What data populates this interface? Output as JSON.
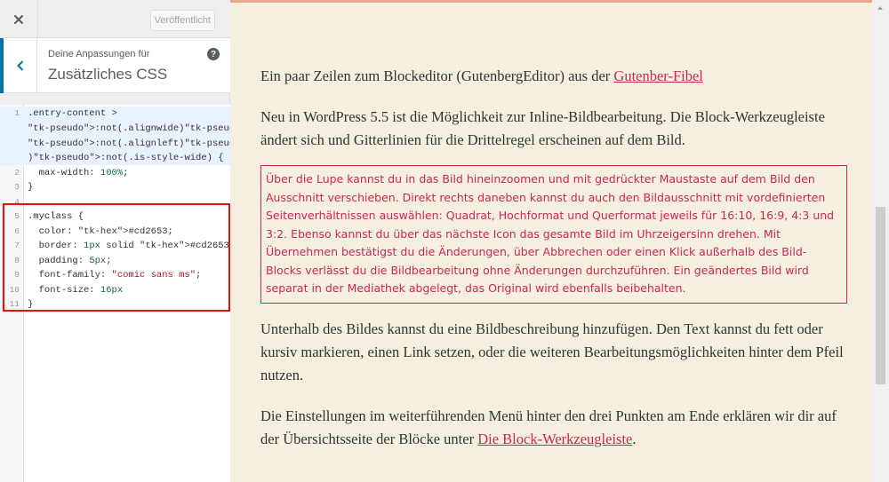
{
  "topbar": {
    "close_icon": "close-icon",
    "publish_label": "Veröffentlicht"
  },
  "section": {
    "back_icon": "chevron-left-icon",
    "kicker": "Deine Anpassungen für",
    "title": "Zusätzliches CSS",
    "help_icon": "help-icon",
    "help_glyph": "?"
  },
  "css_editor": {
    "lines": [
      {
        "n": "1",
        "text": ".entry-content >"
      },
      {
        "n": "",
        "text": ":not(.alignwide):not(.alignfull)"
      },
      {
        "n": "",
        "text": ":not(.alignleft):not(.alignright"
      },
      {
        "n": "",
        "text": "):not(.is-style-wide) {"
      },
      {
        "n": "2",
        "text": "  max-width: 100%;"
      },
      {
        "n": "3",
        "text": "}"
      },
      {
        "n": "4",
        "text": ""
      },
      {
        "n": "5",
        "text": ".myclass {"
      },
      {
        "n": "6",
        "text": "  color: #cd2653;"
      },
      {
        "n": "7",
        "text": "  border: 1px solid #cd2653;"
      },
      {
        "n": "8",
        "text": "  padding: 5px;"
      },
      {
        "n": "9",
        "text": "  font-family: \"comic sans ms\";"
      },
      {
        "n": "10",
        "text": "  font-size: 16px"
      },
      {
        "n": "11",
        "text": "}"
      }
    ]
  },
  "preview": {
    "p1_text": "Ein paar Zeilen zum Blockeditor (GutenbergEditor) aus der ",
    "p1_link": "Gutenber-Fibel",
    "p2_text": "Neu in WordPress 5.5 ist die Möglichkeit zur Inline-Bildbearbeitung. Die Block-Werkzeugleiste ändert sich und Gitterlinien für die Drittelregel erscheinen auf dem Bild.",
    "p3_text": "Über die Lupe kannst du in das Bild hineinzoomen und mit gedrückter Maustaste auf dem Bild den Ausschnitt verschieben. Direkt rechts daneben kannst du auch den Bildausschnitt mit vordefinierten Seitenverhältnissen auswählen: Quadrat, Hochformat und Querformat jeweils für 16:10, 16:9, 4:3 und 3:2. Ebenso kannst du über das nächste Icon das gesamte Bild im Uhrzeigersinn drehen. Mit Übernehmen bestätigst du die Änderungen, über Abbrechen oder einen Klick außerhalb des Bild-Blocks verlässt du die Bildbearbeitung ohne Änderungen durchzuführen. Ein geändertes Bild wird separat in der Mediathek abgelegt, das Original wird ebenfalls beibehalten.",
    "p4_text": "Unterhalb des Bildes kannst du eine Bildbeschreibung hinzufügen. Den Text kannst du fett oder kursiv markieren, einen Link setzen, oder die weiteren Bearbeitungsmöglichkeiten hinter dem Pfeil nutzen.",
    "p5_text": "Die Einstellungen im weiterführenden Menü hinter den drei Punkten am Ende erklären wir dir auf der Übersichtsseite der Blöcke unter ",
    "p5_link": "Die Block-Werkzeugleiste",
    "p5_end": "."
  },
  "colors": {
    "accent": "#0073aa",
    "myclass": "#cd2653",
    "highlight_box": "#e0140f",
    "preview_bg": "#f5efe0"
  }
}
